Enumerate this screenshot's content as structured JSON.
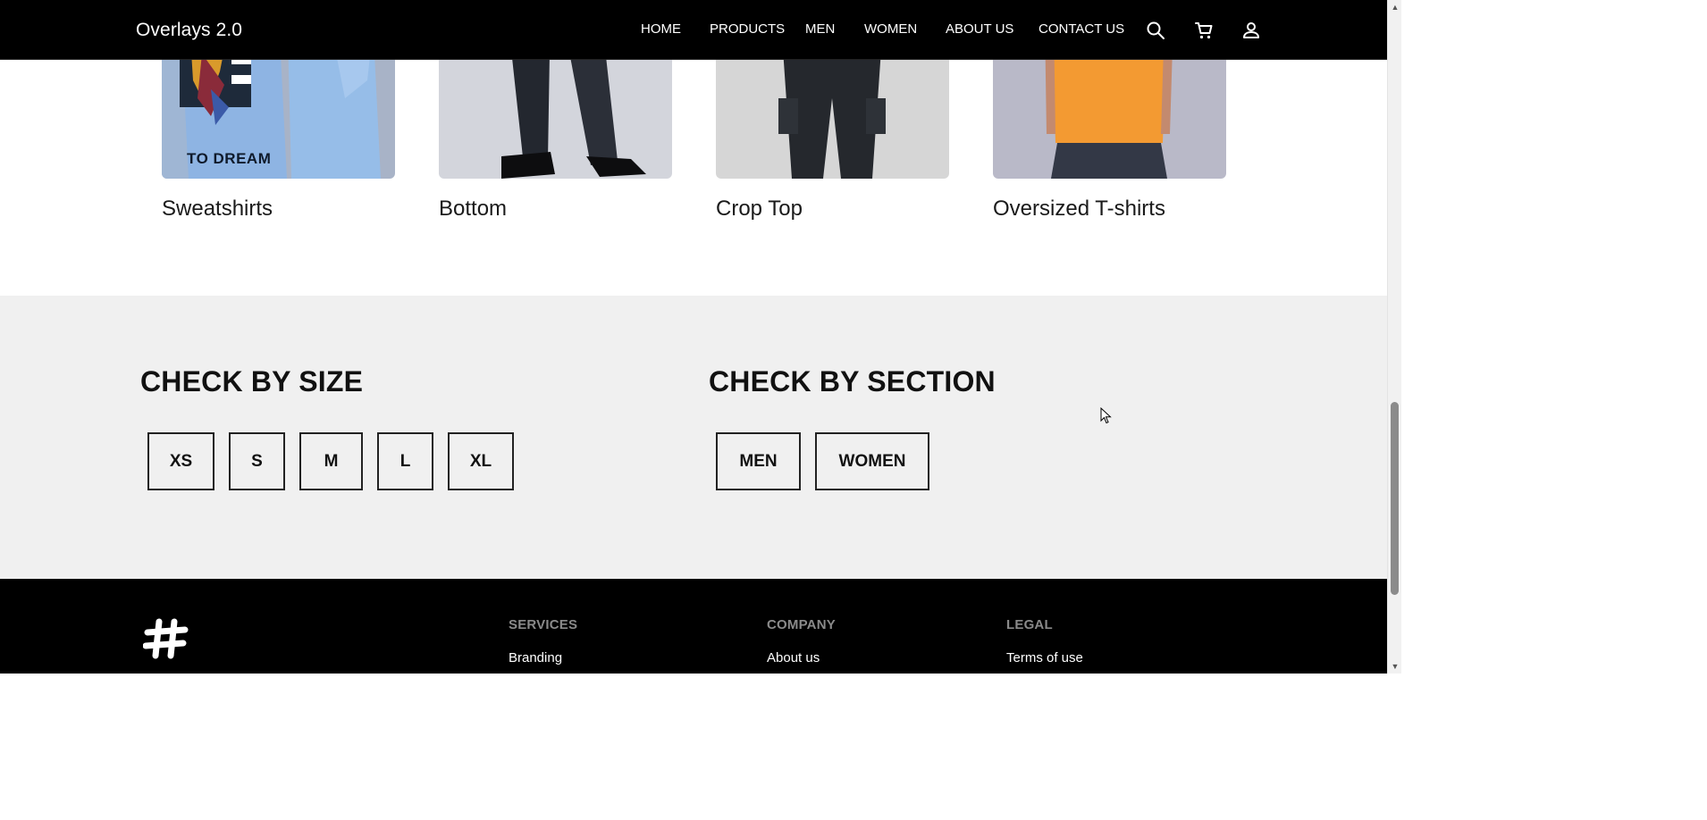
{
  "header": {
    "brand": "Overlays 2.0",
    "nav": [
      "HOME",
      "PRODUCTS",
      "MEN",
      "WOMEN",
      "ABOUT US",
      "CONTACT US"
    ],
    "icons": [
      "search-icon",
      "cart-icon",
      "user-icon"
    ]
  },
  "categories": [
    {
      "label": "Sweatshirts"
    },
    {
      "label": "Bottom"
    },
    {
      "label": "Crop Top"
    },
    {
      "label": "Oversized T-shirts"
    }
  ],
  "card_image_text": "TO DREAM",
  "size_section": {
    "heading": "CHECK BY SIZE",
    "options": [
      "XS",
      "S",
      "M",
      "L",
      "XL"
    ]
  },
  "gender_section": {
    "heading": "CHECK BY SECTION",
    "options": [
      "MEN",
      "WOMEN"
    ]
  },
  "footer": {
    "logo": "hash-logo-icon",
    "columns": [
      {
        "heading": "SERVICES",
        "link": "Branding"
      },
      {
        "heading": "COMPANY",
        "link": "About us"
      },
      {
        "heading": "LEGAL",
        "link": "Terms of use"
      }
    ]
  },
  "colors": {
    "header_bg": "#000000",
    "filter_bg": "#f0f0f0",
    "footer_bg": "#000000",
    "footer_heading": "#8a8a8a"
  }
}
